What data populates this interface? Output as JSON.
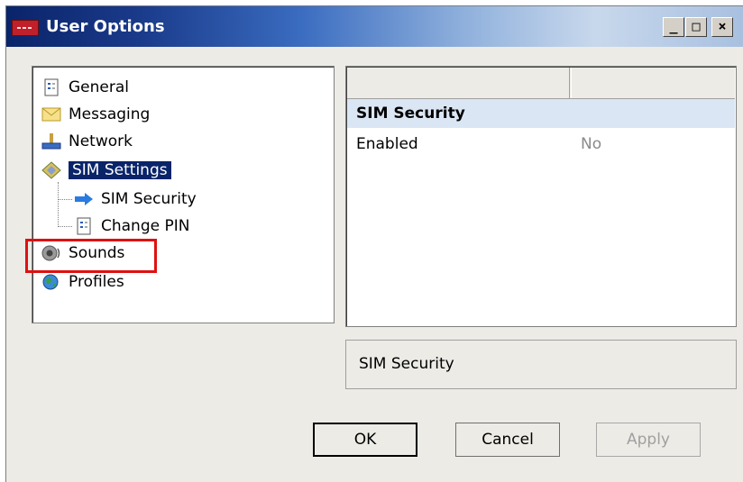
{
  "window": {
    "title": "User Options",
    "controls": {
      "minimize": "_",
      "maximize": "□",
      "close": "×"
    }
  },
  "tree": {
    "items": [
      {
        "label": "General",
        "icon": "document-icon"
      },
      {
        "label": "Messaging",
        "icon": "envelope-icon"
      },
      {
        "label": "Network",
        "icon": "network-icon"
      },
      {
        "label": "SIM Settings",
        "icon": "sim-card-icon",
        "selected": true
      },
      {
        "label": "SIM Security",
        "icon": "arrow-right-icon"
      },
      {
        "label": "Change PIN",
        "icon": "document-icon"
      },
      {
        "label": "Sounds",
        "icon": "speaker-icon",
        "highlighted": true
      },
      {
        "label": "Profiles",
        "icon": "globe-icon"
      }
    ]
  },
  "properties": {
    "section": "SIM Security",
    "rows": [
      {
        "name": "Enabled",
        "value": "No"
      }
    ]
  },
  "description": "SIM Security",
  "buttons": {
    "ok": "OK",
    "cancel": "Cancel",
    "apply": "Apply"
  },
  "colors": {
    "selection": "#0a246a",
    "highlight_box": "#e01010",
    "section_bg": "#dbe6f4"
  }
}
